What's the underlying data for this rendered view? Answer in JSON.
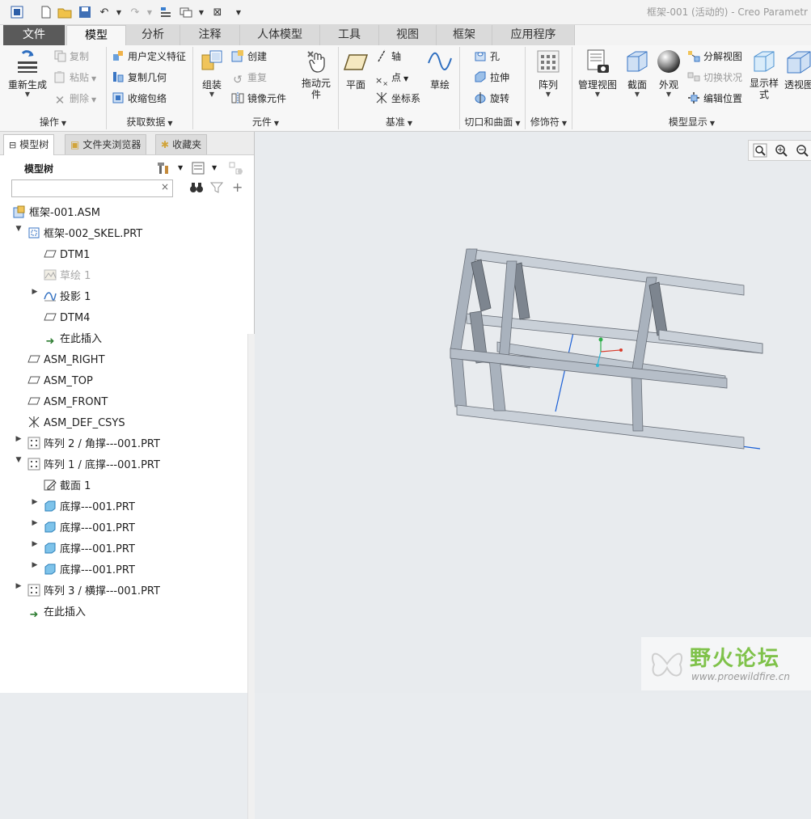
{
  "window": {
    "title": "框架-001 (活动的) - Creo Parametr"
  },
  "ribbon": {
    "tabs": [
      {
        "label": "文件"
      },
      {
        "label": "模型"
      },
      {
        "label": "分析"
      },
      {
        "label": "注释"
      },
      {
        "label": "人体模型"
      },
      {
        "label": "工具"
      },
      {
        "label": "视图"
      },
      {
        "label": "框架"
      },
      {
        "label": "应用程序"
      }
    ],
    "operations": {
      "regenerate": "重新生成",
      "copy": "复制",
      "paste": "粘贴",
      "delete": "删除",
      "group": "操作"
    },
    "get_data": {
      "udf": "用户定义特征",
      "copy_geom": "复制几何",
      "shrinkwrap": "收缩包络",
      "group": "获取数据"
    },
    "component": {
      "assemble": "组装",
      "create": "创建",
      "repeat": "重复",
      "mirror": "镜像元件",
      "drag_line1": "拖动元",
      "drag_line2": "件",
      "group": "元件"
    },
    "datum": {
      "plane": "平面",
      "axis": "轴",
      "point": "点",
      "csys": "坐标系",
      "sketch": "草绘",
      "group": "基准"
    },
    "cut_surface": {
      "hole": "孔",
      "extrude": "拉伸",
      "revolve": "旋转",
      "group": "切口和曲面"
    },
    "modifiers": {
      "pattern": "阵列",
      "group": "修饰符"
    },
    "model_display": {
      "manage_views": "管理视图",
      "section": "截面",
      "appearance": "外观",
      "exploded": "分解视图",
      "toggle_status": "切换状况",
      "edit_position": "编辑位置",
      "display_style_line1": "显示样",
      "display_style_line2": "式",
      "perspective": "透视图",
      "group": "模型显示"
    }
  },
  "panel": {
    "tabs": [
      {
        "label": "模型树"
      },
      {
        "label": "文件夹浏览器"
      },
      {
        "label": "收藏夹"
      }
    ],
    "tree_title": "模型树",
    "search_value": "",
    "search_clear": "×"
  },
  "tree": [
    {
      "label": "框架-001.ASM"
    },
    {
      "label": "框架-002_SKEL.PRT"
    },
    {
      "label": "DTM1"
    },
    {
      "label": "草绘 1"
    },
    {
      "label": "投影 1"
    },
    {
      "label": "DTM4"
    },
    {
      "label": "在此插入"
    },
    {
      "label": "ASM_RIGHT"
    },
    {
      "label": "ASM_TOP"
    },
    {
      "label": "ASM_FRONT"
    },
    {
      "label": "ASM_DEF_CSYS"
    },
    {
      "label": "阵列 2 / 角撑---001.PRT"
    },
    {
      "label": "阵列 1 / 底撑---001.PRT"
    },
    {
      "label": "截面 1"
    },
    {
      "label": "底撑---001.PRT"
    },
    {
      "label": "底撑---001.PRT"
    },
    {
      "label": "底撑---001.PRT"
    },
    {
      "label": "底撑---001.PRT"
    },
    {
      "label": "阵列 3 / 横撑---001.PRT"
    },
    {
      "label": "在此插入"
    }
  ],
  "watermark": {
    "text": "野火论坛",
    "url": "www.proewildfire.cn"
  },
  "colors": {
    "frame_front": "#a9b2bd",
    "frame_top": "#c9d0d8",
    "frame_dark": "#6a7079",
    "datum_blue": "#1a5fd6",
    "file_tab": "#5a5a5a"
  }
}
